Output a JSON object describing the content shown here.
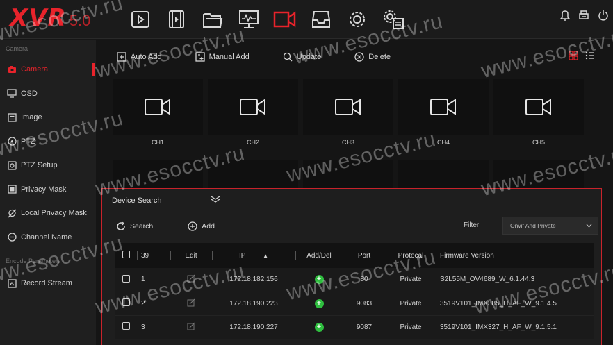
{
  "app": {
    "brand": "XVR",
    "version": "5.0"
  },
  "topnav": [
    "playback-icon",
    "video-clip-icon",
    "folder-icon",
    "monitor-icon",
    "camera-icon",
    "storage-icon",
    "settings-icon",
    "system-settings-icon"
  ],
  "topnav_active_color": "#e8232b",
  "top_right_icons": [
    "bell-icon",
    "print-icon",
    "power-icon"
  ],
  "sidebar": {
    "section_camera": "Camera",
    "items": [
      {
        "label": "Camera",
        "icon": "camera-icon",
        "active": true
      },
      {
        "label": "OSD",
        "icon": "osd-icon"
      },
      {
        "label": "Image",
        "icon": "image-icon"
      },
      {
        "label": "PTZ",
        "icon": "ptz-icon"
      },
      {
        "label": "PTZ Setup",
        "icon": "ptz-setup-icon"
      },
      {
        "label": "Privacy Mask",
        "icon": "privacy-mask-icon"
      },
      {
        "label": "Local Privacy Mask",
        "icon": "local-privacy-mask-icon"
      },
      {
        "label": "Channel Name",
        "icon": "channel-name-icon"
      }
    ],
    "section_encode": "Encode Parameters",
    "encode_items": [
      {
        "label": "Record Stream",
        "icon": "record-stream-icon"
      }
    ]
  },
  "toolbar": {
    "auto_add": "Auto Add",
    "manual_add": "Manual Add",
    "update": "Update",
    "delete": "Delete"
  },
  "channels": [
    "CH1",
    "CH2",
    "CH3",
    "CH4",
    "CH5"
  ],
  "device_search": {
    "title": "Device Search",
    "search": "Search",
    "add": "Add",
    "filter_label": "Filter",
    "filter_value": "Onvif And Private",
    "columns": {
      "count": "39",
      "edit": "Edit",
      "ip": "IP",
      "add_del": "Add/Del",
      "port": "Port",
      "protocol": "Protocal",
      "firmware": "Firmware Version"
    },
    "rows": [
      {
        "num": "1",
        "ip": "172.18.182.156",
        "port": "80",
        "protocol": "Private",
        "firmware": "S2L55M_OV4689_W_6.1.44.3"
      },
      {
        "num": "2",
        "ip": "172.18.190.223",
        "port": "9083",
        "protocol": "Private",
        "firmware": "3519V101_IMX385_H_AF_W_9.1.4.5"
      },
      {
        "num": "3",
        "ip": "172.18.190.227",
        "port": "9087",
        "protocol": "Private",
        "firmware": "3519V101_IMX327_H_AF_W_9.1.5.1"
      }
    ]
  },
  "watermark": "www.esocctv.ru"
}
